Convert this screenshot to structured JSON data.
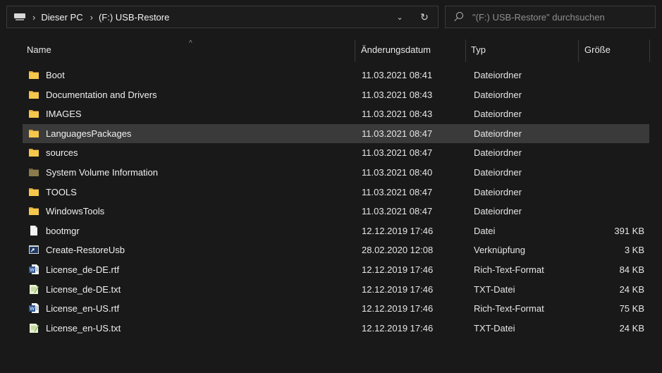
{
  "address_bar": {
    "separator": "›",
    "crumbs": [
      "Dieser PC",
      "(F:) USB-Restore"
    ],
    "dropdown_glyph": "⌄",
    "refresh_glyph": "↻"
  },
  "search": {
    "placeholder": "\"(F:) USB-Restore\" durchsuchen",
    "value": ""
  },
  "columns": {
    "name": "Name",
    "date": "Änderungsdatum",
    "type": "Typ",
    "size": "Größe",
    "sort_indicator": "^"
  },
  "files": [
    {
      "name": "Boot",
      "date": "11.03.2021 08:41",
      "type": "Dateiordner",
      "size": "",
      "icon": "folder-icon"
    },
    {
      "name": "Documentation and Drivers",
      "date": "11.03.2021 08:43",
      "type": "Dateiordner",
      "size": "",
      "icon": "folder-icon"
    },
    {
      "name": "IMAGES",
      "date": "11.03.2021 08:43",
      "type": "Dateiordner",
      "size": "",
      "icon": "folder-icon"
    },
    {
      "name": "LanguagesPackages",
      "date": "11.03.2021 08:47",
      "type": "Dateiordner",
      "size": "",
      "icon": "folder-icon",
      "selected": true
    },
    {
      "name": "sources",
      "date": "11.03.2021 08:47",
      "type": "Dateiordner",
      "size": "",
      "icon": "folder-icon"
    },
    {
      "name": "System Volume Information",
      "date": "11.03.2021 08:40",
      "type": "Dateiordner",
      "size": "",
      "icon": "system-folder-icon"
    },
    {
      "name": "TOOLS",
      "date": "11.03.2021 08:47",
      "type": "Dateiordner",
      "size": "",
      "icon": "folder-icon"
    },
    {
      "name": "WindowsTools",
      "date": "11.03.2021 08:47",
      "type": "Dateiordner",
      "size": "",
      "icon": "folder-icon"
    },
    {
      "name": "bootmgr",
      "date": "12.12.2019 17:46",
      "type": "Datei",
      "size": "391 KB",
      "icon": "file-icon"
    },
    {
      "name": "Create-RestoreUsb",
      "date": "28.02.2020 12:08",
      "type": "Verknüpfung",
      "size": "3 KB",
      "icon": "shortcut-icon"
    },
    {
      "name": "License_de-DE.rtf",
      "date": "12.12.2019 17:46",
      "type": "Rich-Text-Format",
      "size": "84 KB",
      "icon": "rtf-icon"
    },
    {
      "name": "License_de-DE.txt",
      "date": "12.12.2019 17:46",
      "type": "TXT-Datei",
      "size": "24 KB",
      "icon": "txt-icon"
    },
    {
      "name": "License_en-US.rtf",
      "date": "12.12.2019 17:46",
      "type": "Rich-Text-Format",
      "size": "75 KB",
      "icon": "rtf-icon"
    },
    {
      "name": "License_en-US.txt",
      "date": "12.12.2019 17:46",
      "type": "TXT-Datei",
      "size": "24 KB",
      "icon": "txt-icon"
    }
  ],
  "colors": {
    "background": "#191919",
    "selection": "#3a3a3a",
    "folder": "#f5c84c",
    "system_folder": "#8a7a4c"
  }
}
